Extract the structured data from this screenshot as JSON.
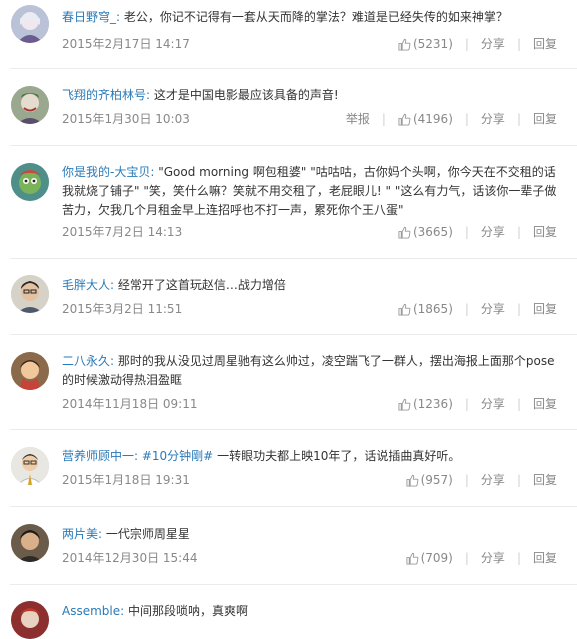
{
  "labels": {
    "report": "举报",
    "share": "分享",
    "reply": "回复"
  },
  "comments": [
    {
      "user": "春日野穹_:",
      "tag": "",
      "text": " 老公，你记不记得有一套从天而降的掌法？难道是已经失传的如来神掌？",
      "time": "2015年2月17日 14:17",
      "likes": "(5231)"
    },
    {
      "user": "飞翔的齐柏林号:",
      "tag": "",
      "text": " 这才是中国电影最应该具备的声音!",
      "time": "2015年1月30日 10:03",
      "likes": "(4196)"
    },
    {
      "user": "你是我的-大宝贝:",
      "tag": "",
      "text": " \"Good morning 啊包租婆\" \"咕咕咕，古你妈个头啊，你今天在不交租的话我就烧了铺子\" \"笑，笑什么嘛？笑就不用交租了，老屁眼儿! \" \"这么有力气，话该你一辈子做苦力，欠我几个月租金早上连招呼也不打一声，累死你个王八蛋\"",
      "time": "2015年7月2日 14:13",
      "likes": "(3665)"
    },
    {
      "user": "毛胖大人:",
      "tag": "",
      "text": " 经常开了这首玩赵信…战力增倍",
      "time": "2015年3月2日 11:51",
      "likes": "(1865)"
    },
    {
      "user": "二八永久:",
      "tag": "",
      "text": " 那时的我从没见过周星驰有这么帅过，凌空踹飞了一群人，摆出海报上面那个pose的时候激动得热泪盈眶",
      "time": "2014年11月18日 09:11",
      "likes": "(1236)"
    },
    {
      "user": "营养师顾中一:",
      "tag": " #10分钟剛#",
      "text": " 一转眼功夫都上映10年了，话说插曲真好听。",
      "time": "2015年1月18日 19:31",
      "likes": "(957)"
    },
    {
      "user": "两片美:",
      "tag": "",
      "text": " 一代宗师周星星",
      "time": "2014年12月30日 15:44",
      "likes": "(709)"
    },
    {
      "user": "Assemble:",
      "tag": "",
      "text": " 中间那段唢呐，真爽啊",
      "time": "",
      "likes": ""
    }
  ]
}
